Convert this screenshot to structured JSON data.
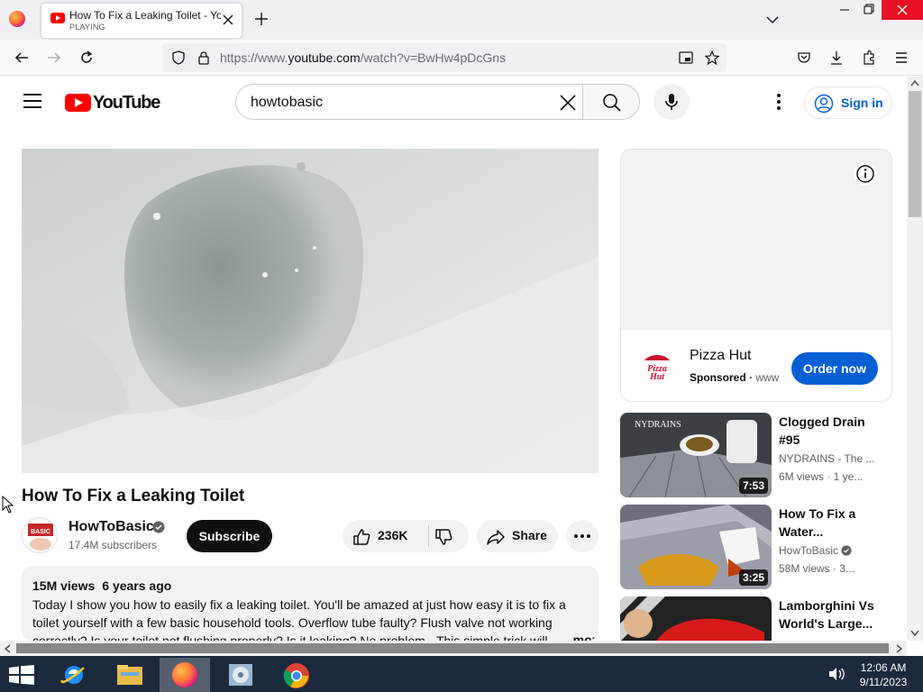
{
  "browser": {
    "tab": {
      "title": "How To Fix a Leaking Toilet - YouTube",
      "status": "PLAYING"
    },
    "url": {
      "prefix": "https://www.",
      "host": "youtube.com",
      "path": "/watch?v=BwHw4pDcGns"
    }
  },
  "youtube": {
    "logo_text": "YouTube",
    "search_value": "howtobasic",
    "sign_in_label": "Sign in",
    "video": {
      "title": "How To Fix a Leaking Toilet",
      "channel": "HowToBasic",
      "subscribers": "17.4M subscribers",
      "subscribe_label": "Subscribe",
      "likes": "236K",
      "share_label": "Share",
      "views": "15M views",
      "age": "6 years ago",
      "description": "Today I show you how to easily fix a leaking toilet.  You'll be amazed at just how easy it is to fix a toilet yourself with a few basic household tools. Overflow tube faulty? Flush valve not working correctly? Is your toilet not flushing properly? Is it leaking? No problem - This simple trick will",
      "more_label": "...more"
    },
    "ad": {
      "advertiser": "Pizza Hut",
      "sponsored": "Sponsored",
      "domain": "www",
      "cta": "Order now",
      "logo_text_1": "Pizza",
      "logo_text_2": "Hut"
    },
    "recommendations": [
      {
        "title": "Clogged Drain #95",
        "channel": "NYDRAINS - The ...",
        "views": "6M views · 1 ye...",
        "duration": "7:53",
        "thumb_label": "NYDRAINS"
      },
      {
        "title": "How To Fix a Water...",
        "channel": "HowToBasic",
        "views": "58M views · 3...",
        "duration": "3:25"
      },
      {
        "title": "Lamborghini Vs World's Large...",
        "channel": "",
        "views": "",
        "duration": ""
      }
    ]
  },
  "taskbar": {
    "time": "12:06 AM",
    "date": "9/11/2023"
  },
  "colors": {
    "yt_red": "#ff0000",
    "link_blue": "#065fd4",
    "taskbar": "#1c2a3d"
  }
}
